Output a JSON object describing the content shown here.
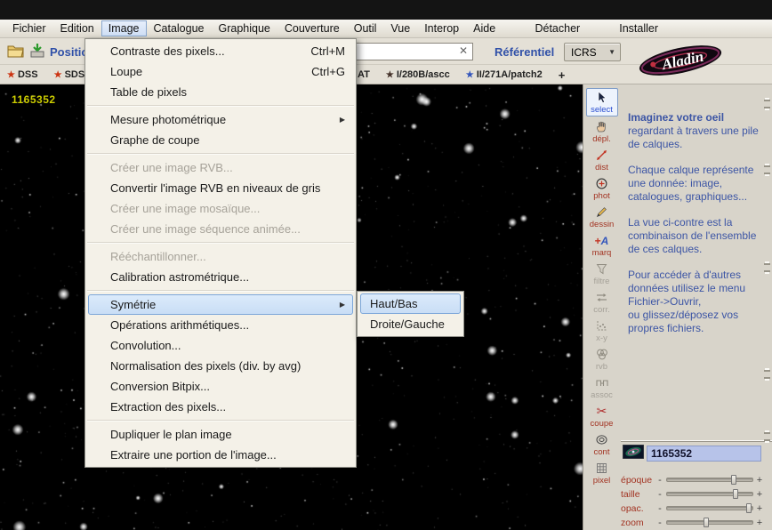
{
  "colors": {
    "accent_blue": "#3c55a5",
    "menu_highlight_border": "#7da7d9",
    "tool_label_red": "#a23322",
    "selection_blue": "#b7c3e9",
    "plane_label_yellow": "#cccc00"
  },
  "menubar": {
    "items": [
      "Fichier",
      "Edition",
      "Image",
      "Catalogue",
      "Graphique",
      "Couverture",
      "Outil",
      "Vue",
      "Interop",
      "Aide"
    ],
    "active_item": "Image",
    "right_items": [
      "Détacher",
      "Installer"
    ]
  },
  "toolbar": {
    "position_label": "Position",
    "search": {
      "value": "",
      "clear_icon": "✕"
    },
    "referentiel_label": "Référentiel",
    "frame_value": "ICRS",
    "frame_arrow": "▼",
    "logo_text": "Aladin"
  },
  "tabs": {
    "items_left": [
      {
        "star": "★",
        "label": "DSS"
      },
      {
        "star": "★",
        "label": "SDSS"
      }
    ],
    "items_right": [
      {
        "label": "AT"
      },
      {
        "star": "★",
        "label": "I/280B/ascc"
      },
      {
        "star": "★",
        "label": "II/271A/patch2"
      },
      {
        "label": "+"
      }
    ]
  },
  "image_menu": {
    "submenu_arrow": "▶",
    "items": [
      {
        "label": "Contraste des pixels...",
        "shortcut": "Ctrl+M"
      },
      {
        "label": "Loupe",
        "shortcut": "Ctrl+G"
      },
      {
        "label": "Table de pixels"
      },
      {
        "label": "Mesure photométrique",
        "submenu": true
      },
      {
        "label": "Graphe de coupe"
      },
      {
        "label": "Créer une image RVB...",
        "disabled": true
      },
      {
        "label": "Convertir l'image RVB en niveaux de gris"
      },
      {
        "label": "Créer une image mosaïque...",
        "disabled": true
      },
      {
        "label": "Créer une image séquence animée...",
        "disabled": true
      },
      {
        "label": "Rééchantillonner...",
        "disabled": true
      },
      {
        "label": "Calibration astrométrique..."
      },
      {
        "label": "Symétrie",
        "submenu": true,
        "highlighted": true
      },
      {
        "label": "Opérations arithmétiques..."
      },
      {
        "label": "Convolution..."
      },
      {
        "label": "Normalisation des pixels (div. by avg)"
      },
      {
        "label": "Conversion Bitpix..."
      },
      {
        "label": "Extraction des pixels..."
      },
      {
        "label": "Dupliquer le plan image"
      },
      {
        "label": "Extraire une portion de l'image..."
      }
    ]
  },
  "symetrie_submenu": {
    "items": [
      {
        "label": "Haut/Bas",
        "highlighted": true
      },
      {
        "label": "Droite/Gauche"
      }
    ]
  },
  "viewer": {
    "plane_label": "1165352"
  },
  "side_toolbar": {
    "marq_plus": "+",
    "marq_a": "A",
    "coupe_glyph": "✂",
    "tools": [
      {
        "label": "select"
      },
      {
        "label": "dépl."
      },
      {
        "label": "dist"
      },
      {
        "label": "phot"
      },
      {
        "label": "dessin"
      },
      {
        "label": "marq"
      },
      {
        "label": "filtre",
        "disabled": true
      },
      {
        "label": "corr.",
        "disabled": true
      },
      {
        "label": "x-y",
        "disabled": true
      },
      {
        "label": "rvb",
        "disabled": true
      },
      {
        "label": "assoc",
        "disabled": true
      },
      {
        "label": "coupe"
      },
      {
        "label": "cont"
      },
      {
        "label": "pixel"
      }
    ]
  },
  "info_panel": {
    "p1_bold": "Imaginez votre oeil",
    "p1_rest": " regardant à travers une pile de calques.",
    "p2": "Chaque calque représente une donnée: image, catalogues, graphiques...",
    "p3": "La vue ci-contre est la combinaison de l'ensemble de ces calques.",
    "p4": "Pour accéder à d'autres données utilisez le menu Fichier->Ouvrir,",
    "p5": "ou glissez/déposez vos propres fichiers."
  },
  "stack_panel": {
    "selected_plane": "1165352"
  },
  "sliders": [
    {
      "label": "époque",
      "minus": "-",
      "plus": "+",
      "value_pct": 78
    },
    {
      "label": "taille",
      "minus": "-",
      "plus": "+",
      "value_pct": 80
    },
    {
      "label": "opac.",
      "minus": "-",
      "plus": "+",
      "value_pct": 96
    },
    {
      "label": "zoom",
      "minus": "-",
      "plus": "+",
      "value_pct": 46
    }
  ]
}
